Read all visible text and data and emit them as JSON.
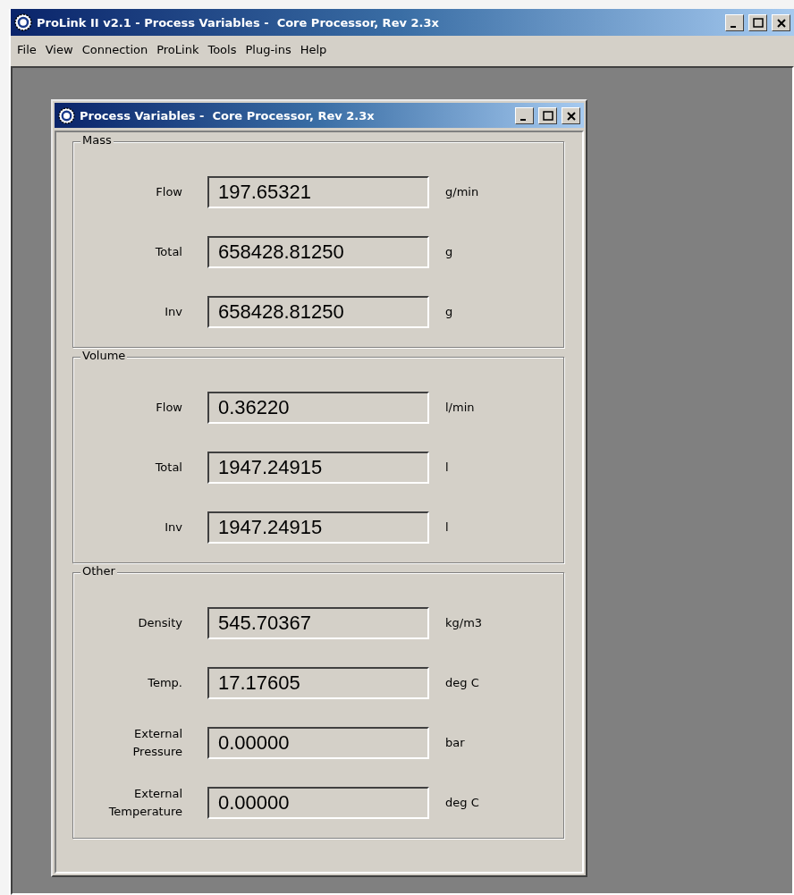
{
  "window": {
    "title": "ProLink II v2.1 - Process Variables -  Core Processor, Rev 2.3x"
  },
  "menu": [
    "File",
    "View",
    "Connection",
    "ProLink",
    "Tools",
    "Plug-ins",
    "Help"
  ],
  "child_window": {
    "title": "Process Variables -  Core Processor, Rev 2.3x",
    "groups": [
      {
        "title": "Mass",
        "rows": [
          {
            "label": "Flow",
            "value": "197.65321",
            "unit": "g/min"
          },
          {
            "label": "Total",
            "value": "658428.81250",
            "unit": "g"
          },
          {
            "label": "Inv",
            "value": "658428.81250",
            "unit": "g"
          }
        ]
      },
      {
        "title": "Volume",
        "rows": [
          {
            "label": "Flow",
            "value": "0.36220",
            "unit": "l/min"
          },
          {
            "label": "Total",
            "value": "1947.24915",
            "unit": "l"
          },
          {
            "label": "Inv",
            "value": "1947.24915",
            "unit": "l"
          }
        ]
      },
      {
        "title": "Other",
        "rows": [
          {
            "label": "Density",
            "value": "545.70367",
            "unit": "kg/m3"
          },
          {
            "label": "Temp.",
            "value": "17.17605",
            "unit": "deg C"
          },
          {
            "label": "External Pressure",
            "value": "0.00000",
            "unit": "bar"
          },
          {
            "label": "External Temperature",
            "value": "0.00000",
            "unit": "deg C"
          }
        ]
      }
    ]
  }
}
